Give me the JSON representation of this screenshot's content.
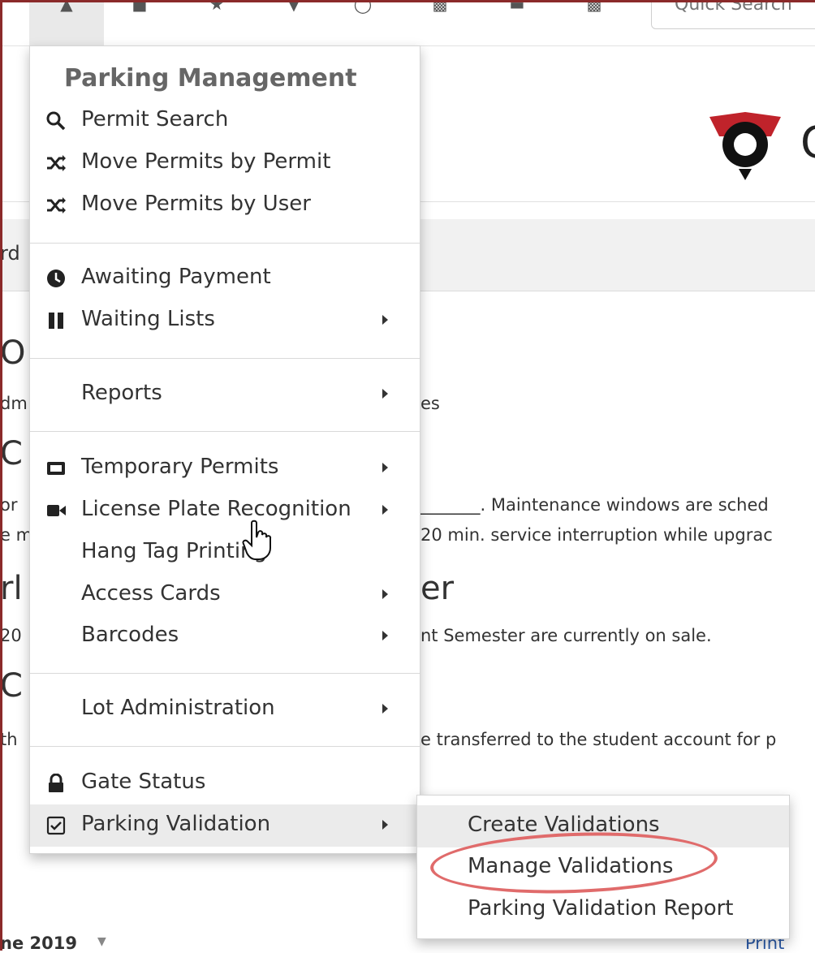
{
  "toolbar": {
    "icons": [
      "home-icon",
      "users-icon",
      "star-icon",
      "pin-icon",
      "clock-icon",
      "binoculars-icon",
      "handshake-icon",
      "building-icon"
    ],
    "search_placeholder": "Quick Search"
  },
  "logo": {
    "letter": "C"
  },
  "background": {
    "tab_fragment": "rd",
    "heading1_fragment": "O",
    "text1_left": "dm",
    "text1_right": "es",
    "heading2_fragment": "C",
    "text2a_left": "or",
    "text2a_right": "_______. Maintenance windows are sched",
    "text2b_left": "e m",
    "text2b_right": "20 min. service interruption while upgrac",
    "heading3_left": "rl",
    "heading3_right": "er",
    "text3_left": "20",
    "text3_right": "nt Semester are currently on sale.",
    "heading4_fragment": "C",
    "text4_left": "th",
    "text4_right": "e transferred to the student account for p",
    "footer_left": "ne 2019",
    "footer_right": "Print"
  },
  "menu": {
    "header": "Parking Management",
    "items": [
      {
        "label": "Permit Search",
        "icon": "search-icon",
        "submenu": false
      },
      {
        "label": "Move Permits by Permit",
        "icon": "shuffle-icon",
        "submenu": false
      },
      {
        "label": "Move Permits by User",
        "icon": "shuffle-icon",
        "submenu": false
      },
      {
        "label": "Awaiting Payment",
        "icon": "clock-icon",
        "submenu": false
      },
      {
        "label": "Waiting Lists",
        "icon": "pause-icon",
        "submenu": true
      },
      {
        "label": "Reports",
        "icon": "",
        "submenu": true
      },
      {
        "label": "Temporary Permits",
        "icon": "ticket-icon",
        "submenu": true
      },
      {
        "label": "License Plate Recognition",
        "icon": "video-camera-icon",
        "submenu": true
      },
      {
        "label": "Hang Tag Printing",
        "icon": "",
        "submenu": false
      },
      {
        "label": "Access Cards",
        "icon": "",
        "submenu": true
      },
      {
        "label": "Barcodes",
        "icon": "",
        "submenu": true
      },
      {
        "label": "Lot Administration",
        "icon": "",
        "submenu": true
      },
      {
        "label": "Gate Status",
        "icon": "lock-icon",
        "submenu": false
      },
      {
        "label": "Parking Validation",
        "icon": "checkbox-icon",
        "submenu": true
      }
    ]
  },
  "submenu": {
    "items": [
      "Create Validations",
      "Manage Validations",
      "Parking Validation Report"
    ],
    "highlighted": "Manage Validations"
  },
  "colors": {
    "annotation": "#e06b6b",
    "frame": "#8b2a2a",
    "logo_red": "#c0232b"
  }
}
